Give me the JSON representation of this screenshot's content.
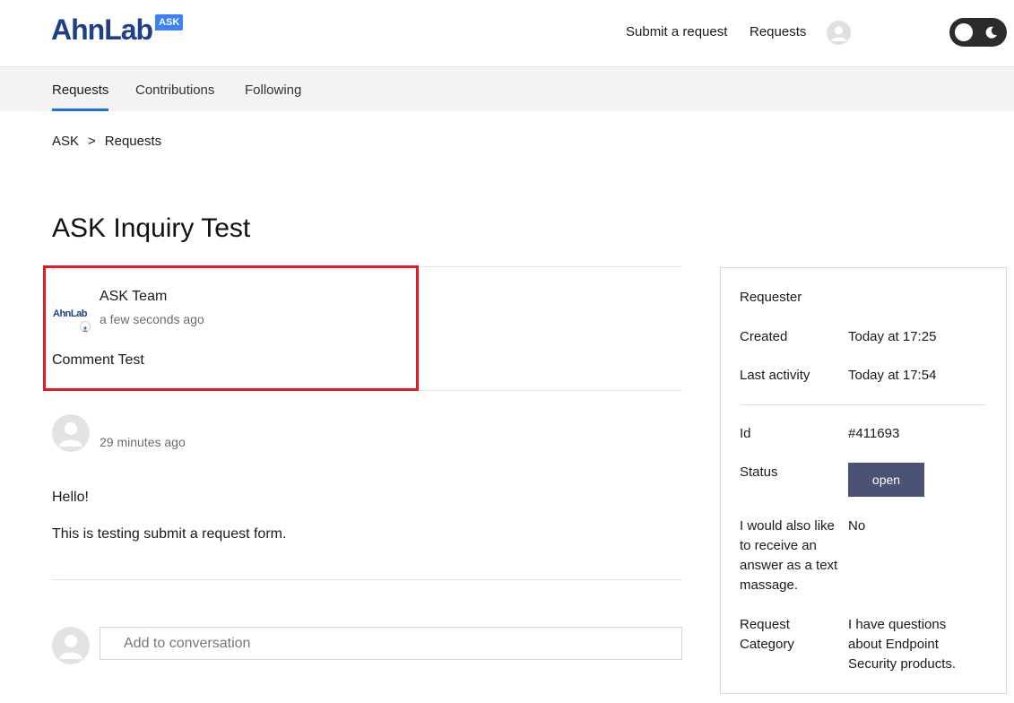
{
  "header": {
    "logo_text": "AhnLab",
    "logo_badge": "ASK",
    "nav": {
      "submit_request": "Submit a request",
      "requests": "Requests"
    }
  },
  "subnav": {
    "tabs": [
      "Requests",
      "Contributions",
      "Following"
    ],
    "active_tab": "Requests"
  },
  "breadcrumb": {
    "root": "ASK",
    "separator": ">",
    "current": "Requests"
  },
  "page": {
    "title": "ASK Inquiry Test"
  },
  "comments": [
    {
      "author": "ASK Team",
      "avatar_logo_text": "AhnLab",
      "time": "a few seconds ago",
      "body": [
        "Comment Test"
      ]
    },
    {
      "author": "",
      "time": "29 minutes ago",
      "body": [
        "Hello!",
        "This is testing submit a request form."
      ]
    }
  ],
  "add_conversation": {
    "placeholder": "Add to conversation"
  },
  "sidebar": {
    "requester_label": "Requester",
    "created_label": "Created",
    "created_value": "Today at 17:25",
    "last_activity_label": "Last activity",
    "last_activity_value": "Today at 17:54",
    "id_label": "Id",
    "id_value": "#411693",
    "status_label": "Status",
    "status_value": "open",
    "text_message_label": "I would also like to receive an answer as a text massage.",
    "text_message_value": "No",
    "category_label": "Request Category",
    "category_value": "I have questions about Endpoint Security products."
  },
  "colors": {
    "accent": "#1f6fe0",
    "logo_blue": "#1f3f8c",
    "status_badge": "#4b5275",
    "highlight": "#e31b23"
  },
  "icons": [
    "user-avatar-icon",
    "theme-toggle-icon",
    "moon-icon"
  ]
}
